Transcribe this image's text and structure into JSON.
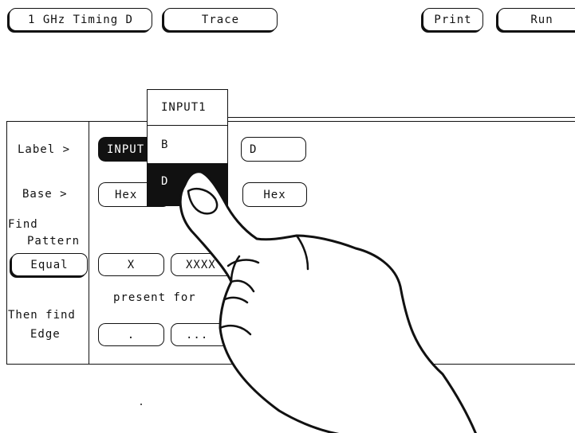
{
  "top_bar": {
    "mode_button": "1 GHz Timing D",
    "trace_button": "Trace",
    "print_button": "Print",
    "run_button": "Run"
  },
  "panel": {
    "label_row": {
      "label": "Label >",
      "field1": "INPUT",
      "field3": "D"
    },
    "base_row": {
      "label": "Base >",
      "field1": "Hex",
      "field3": "Hex"
    },
    "find_pattern": {
      "label_line1": "Find",
      "label_line2": "Pattern",
      "mode": "Equal",
      "value1": "X",
      "value2": "XXXX"
    },
    "present_for": "present for",
    "then_find": {
      "label_line1": "Then find",
      "label_line2": "Edge",
      "edge1": ".",
      "edge2": "..."
    }
  },
  "dropdown": {
    "items": [
      {
        "label": "INPUT1",
        "selected": false
      },
      {
        "label": "B",
        "selected": false
      },
      {
        "label": "D",
        "selected": true
      }
    ]
  },
  "colors": {
    "ink": "#111111",
    "background": "#ffffff"
  }
}
